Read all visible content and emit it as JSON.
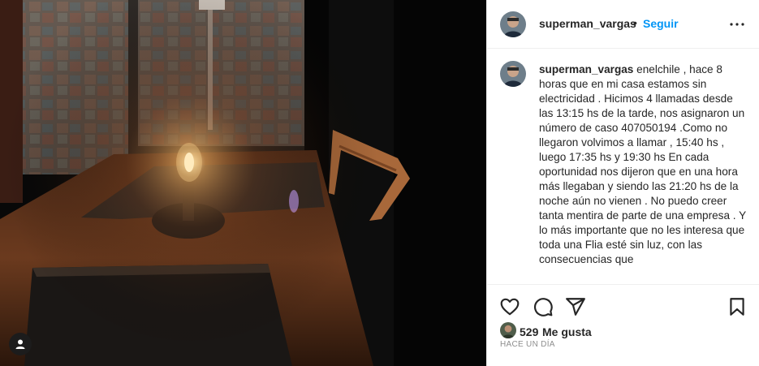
{
  "post": {
    "header": {
      "username": "superman_vargas",
      "separator": "•",
      "follow_label": "Seguir",
      "more_icon": "more-options-icon"
    },
    "caption": {
      "username": "superman_vargas",
      "text": "enelchile , hace 8 horas que en mi casa estamos sin electricidad . Hicimos 4 llamadas desde las 13:15 hs de la tarde, nos asignaron un número de caso 407050194 .Como no llegaron volvimos a llamar , 15:40 hs , luego 17:35 hs y 19:30 hs En cada oportunidad nos dijeron que en una hora más llegaban y siendo las 21:20 hs de la noche aún no vienen . No puedo creer tanta mentira de parte de una empresa . Y lo más importante que no les interesa que toda una Flia esté sin luz, con las consecuencias que"
    },
    "actions": {
      "like_icon": "heart-icon",
      "comment_icon": "comment-icon",
      "share_icon": "paper-plane-icon",
      "save_icon": "bookmark-icon"
    },
    "likes": {
      "count": "529",
      "label": "Me gusta"
    },
    "timestamp": "HACE UN DÍA",
    "photo": {
      "user_tag_icon": "user-tag-icon"
    },
    "colors": {
      "accent": "#0095f6",
      "text": "#262626",
      "muted": "#8e8e8e",
      "border": "#efefef"
    }
  }
}
